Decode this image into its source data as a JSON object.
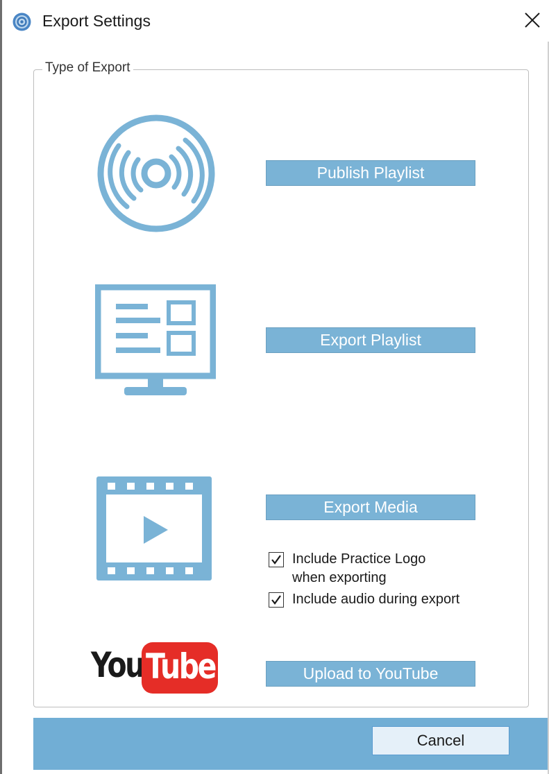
{
  "window": {
    "title": "Export Settings",
    "title_icon": "app-logo-icon",
    "close_icon": "close-icon"
  },
  "group": {
    "label": "Type of Export"
  },
  "actions": [
    {
      "label": "Publish Playlist",
      "icon": "disc-icon"
    },
    {
      "label": "Export Playlist",
      "icon": "monitor-playlist-icon"
    },
    {
      "label": "Export Media",
      "icon": "film-play-icon"
    },
    {
      "label": "Upload to YouTube",
      "icon": "youtube-logo"
    }
  ],
  "options": [
    {
      "label": "Include Practice Logo\n when exporting",
      "checked": true
    },
    {
      "label": "Include audio during export",
      "checked": true
    }
  ],
  "youtube_logo": {
    "you": "You",
    "tube": "Tube"
  },
  "footer": {
    "cancel_label": "Cancel"
  },
  "colors": {
    "accent": "#7ab3d6",
    "footer": "#71aed5",
    "youtube_red": "#e52d27"
  }
}
